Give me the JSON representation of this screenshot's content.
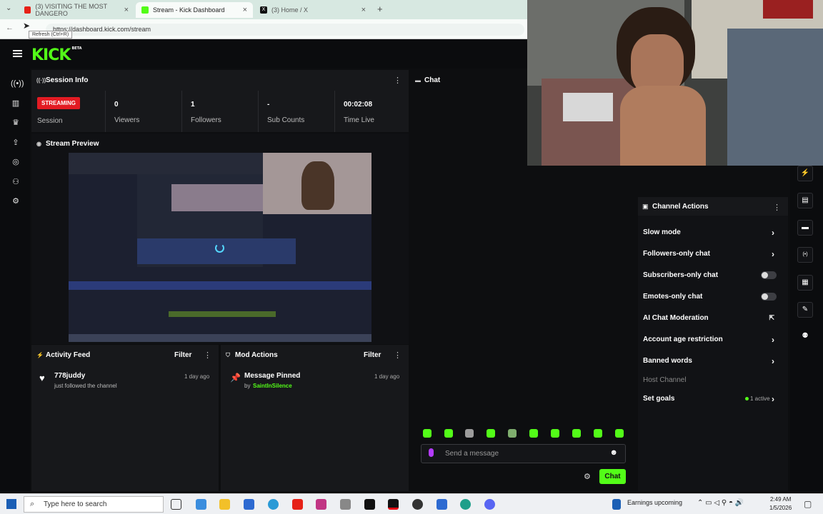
{
  "browser": {
    "tabs": [
      {
        "title": "(3) VISITING THE MOST DANGERO",
        "icon_color": "#e62117"
      },
      {
        "title": "Stream - Kick Dashboard",
        "icon_color": "#53fc18"
      },
      {
        "title": "(3) Home / X",
        "icon_color": "#111111"
      }
    ],
    "url": "https://dashboard.kick.com/stream",
    "tooltip": "Refresh (Ctrl+R)"
  },
  "app": {
    "logo": "KICK",
    "logo_badge": "BETA"
  },
  "session": {
    "title": "Session Info",
    "badge": "STREAMING",
    "session_label": "Session",
    "stats": [
      {
        "value": "0",
        "label": "Viewers"
      },
      {
        "value": "1",
        "label": "Followers"
      },
      {
        "value": "-",
        "label": "Sub Counts"
      },
      {
        "value": "00:02:08",
        "label": "Time Live"
      }
    ]
  },
  "preview": {
    "title": "Stream Preview"
  },
  "activity": {
    "title": "Activity Feed",
    "filter": "Filter",
    "item": {
      "name": "778juddy",
      "sub": "just followed the channel",
      "time": "1 day ago"
    }
  },
  "mod": {
    "title": "Mod Actions",
    "filter": "Filter",
    "item": {
      "name": "Message Pinned",
      "by": "by",
      "user": "SaintInSilence",
      "time": "1 day ago"
    }
  },
  "chat": {
    "title": "Chat",
    "placeholder": "Send a message",
    "send": "Chat"
  },
  "actions": {
    "title": "Channel Actions",
    "items": [
      "Slow mode",
      "Followers-only chat",
      "Subscribers-only chat",
      "Emotes-only chat",
      "AI Chat Moderation",
      "Account age restriction",
      "Banned words"
    ],
    "host": "Host Channel",
    "goals": "Set goals",
    "goals_status": "1 active"
  },
  "taskbar": {
    "search": "Type here to search",
    "news": "Earnings upcoming",
    "time": "2:49 AM",
    "date": "1/5/2026"
  },
  "colors": {
    "accent": "#53fc18",
    "live": "#e31b23",
    "panel": "#17181b"
  }
}
